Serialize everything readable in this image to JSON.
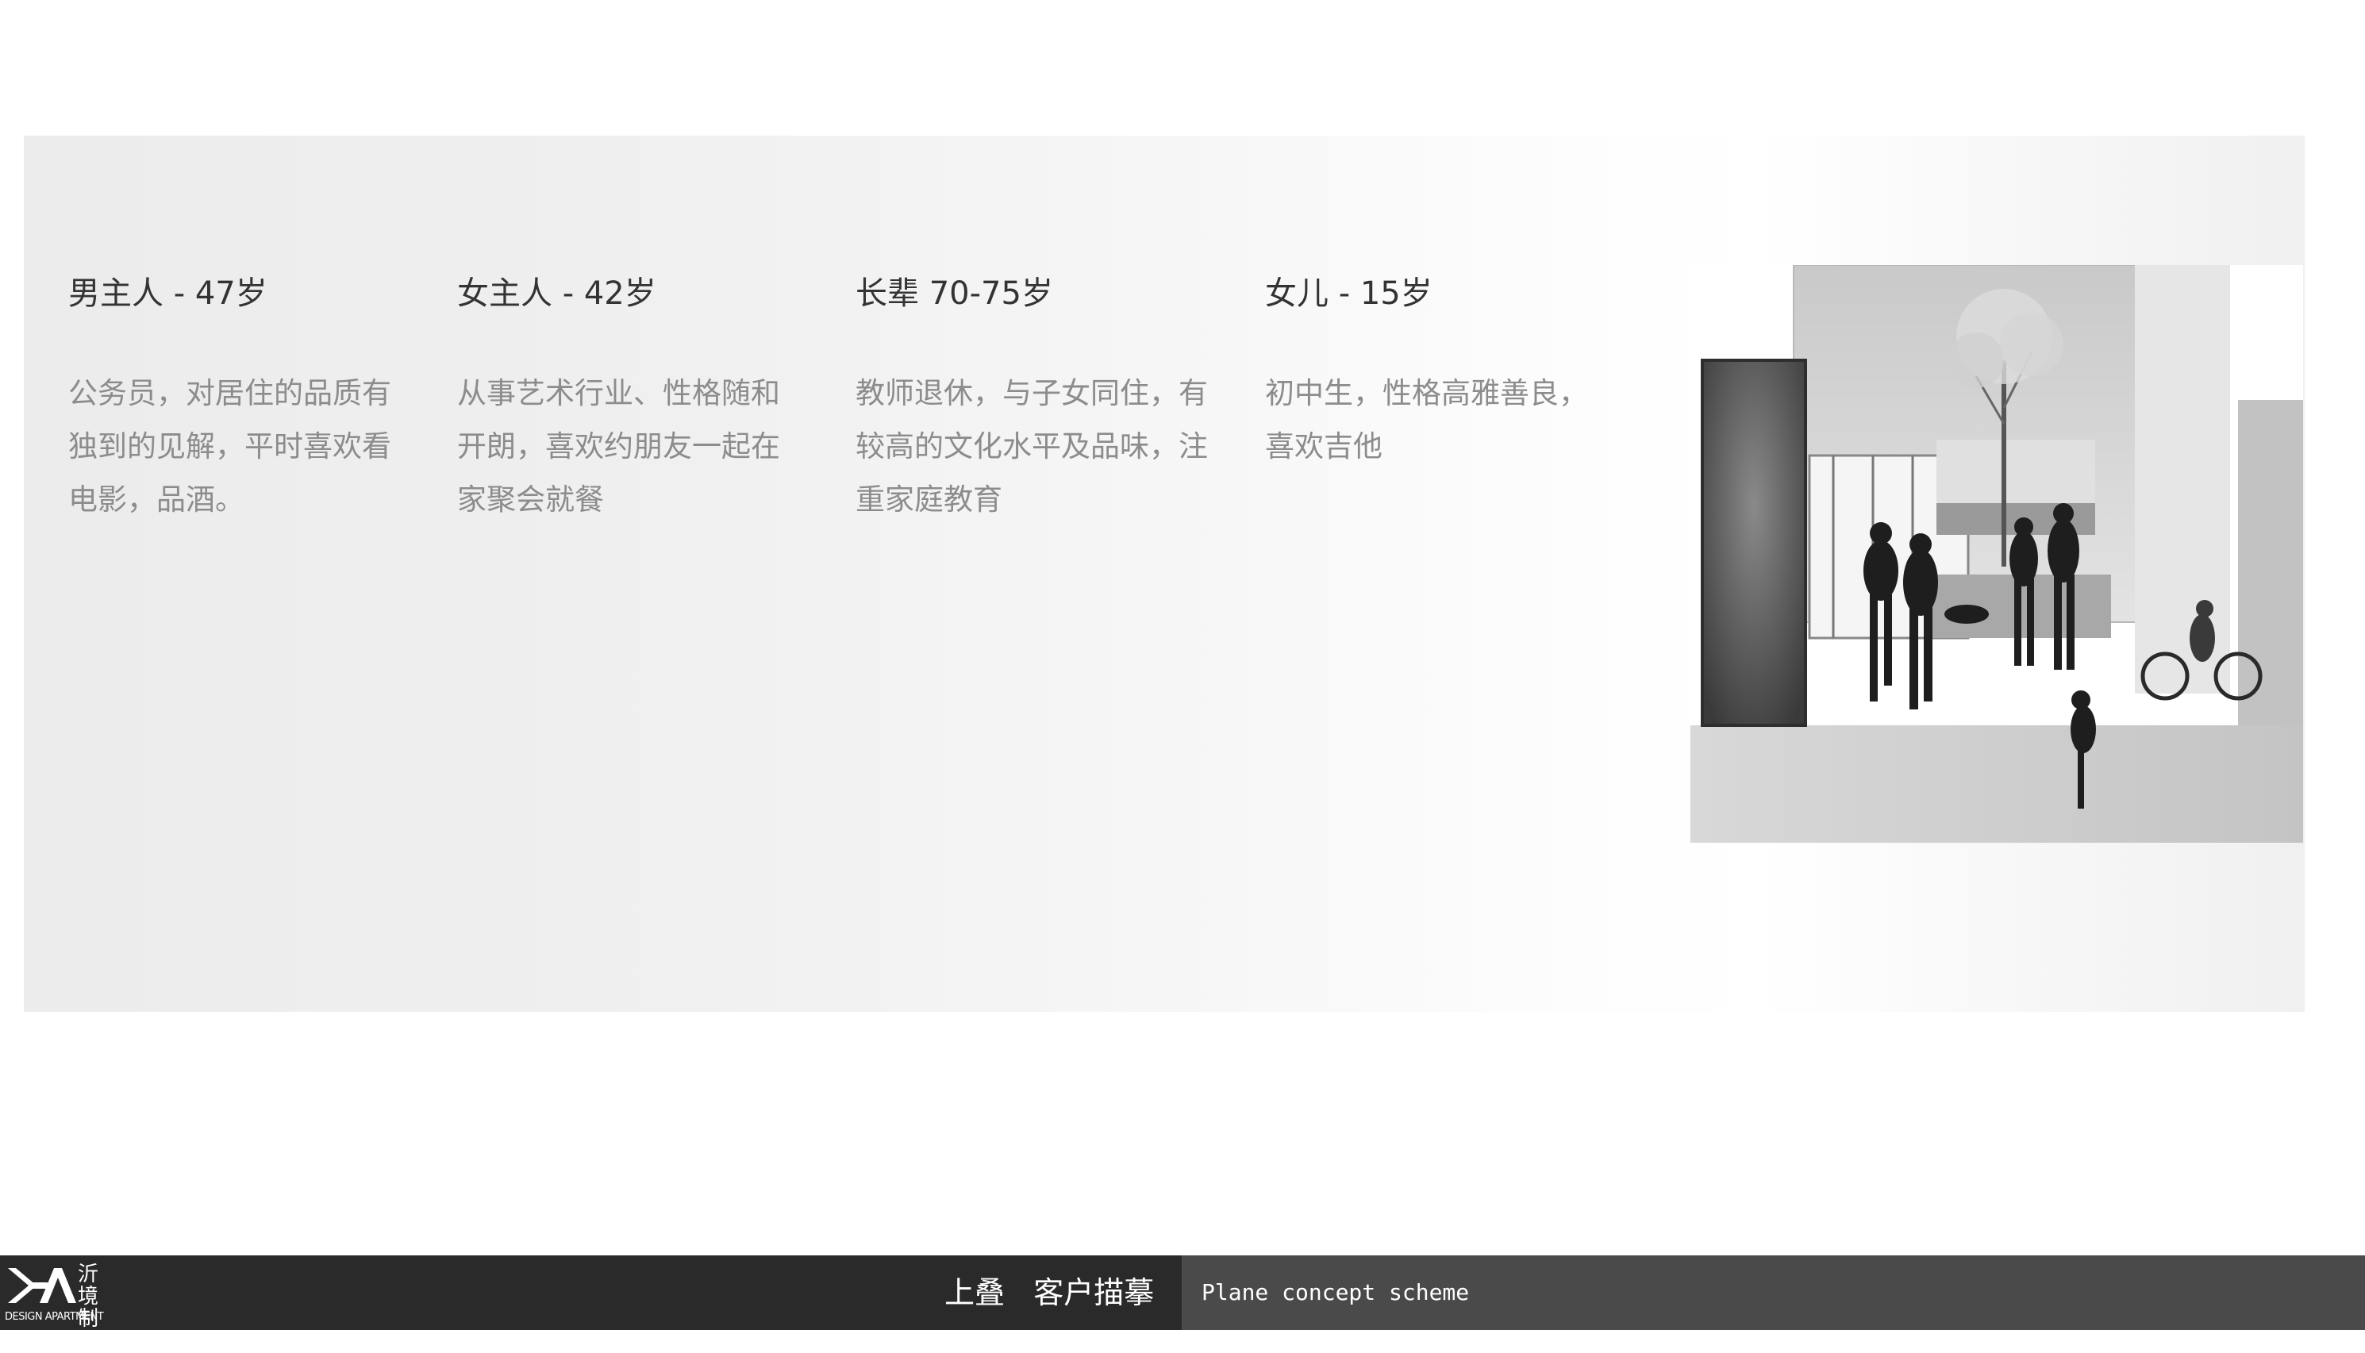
{
  "personas": [
    {
      "title": "男主人 - 47岁",
      "description": "公务员，对居住的品质有独到的见解，平时喜欢看电影，品酒。"
    },
    {
      "title": "女主人 - 42岁",
      "description": "从事艺术行业、性格随和开朗，喜欢约朋友一起在家聚会就餐"
    },
    {
      "title": "长辈  70-75岁",
      "description": "教师退休，与子女同住，有较高的文化水平及品味，注重家庭教育"
    },
    {
      "title": "女儿 - 15岁",
      "description": "初中生，性格高雅善良，喜欢吉他"
    }
  ],
  "footer": {
    "title": "上叠   客户描摹",
    "subtitle": "Plane concept scheme",
    "logo_cn": "沂境制作",
    "logo_en": "DESIGN APARTMENT"
  },
  "colors": {
    "footer_dark": "#2a2a2a",
    "footer_mid": "#4a4a4a",
    "panel": "#efefef"
  }
}
